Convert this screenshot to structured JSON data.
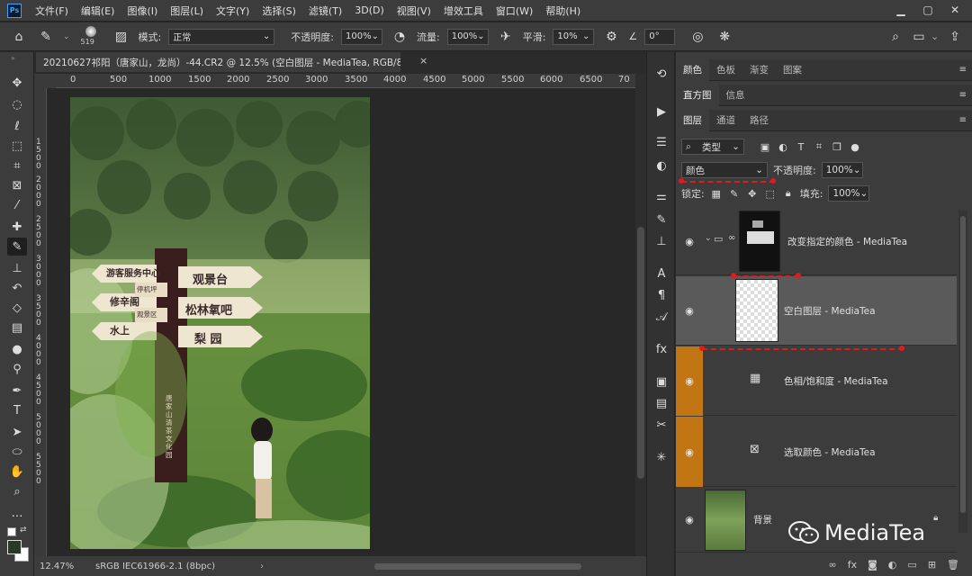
{
  "app": {
    "logo_text": "Ps"
  },
  "menu": [
    "文件(F)",
    "编辑(E)",
    "图像(I)",
    "图层(L)",
    "文字(Y)",
    "选择(S)",
    "滤镜(T)",
    "3D(D)",
    "视图(V)",
    "增效工具",
    "窗口(W)",
    "帮助(H)"
  ],
  "window_controls": {
    "minimize": "▁",
    "maximize": "▢",
    "close": "✕"
  },
  "options": {
    "brush_size": "519",
    "mode_label": "模式:",
    "mode_value": "正常",
    "opacity_label": "不透明度:",
    "opacity_value": "100%",
    "flow_label": "流量:",
    "flow_value": "100%",
    "smooth_label": "平滑:",
    "smooth_value": "10%",
    "angle_value": "0°"
  },
  "document": {
    "tab_title": "20210627祁阳（唐家山，龙尚）-44.CR2 @ 12.5% (空白图层 - MediaTea, RGB/8) *",
    "close": "×",
    "zoom": "12.47%",
    "color_profile": "sRGB IEC61966-2.1 (8bpc)",
    "status_arrow": "›"
  },
  "ruler": {
    "h_ticks": [
      "0",
      "500",
      "1000",
      "1500",
      "2000",
      "2500",
      "3000",
      "3500",
      "4000",
      "4500",
      "5000",
      "5500",
      "6000",
      "6500",
      "70"
    ],
    "v_ticks": [
      "1 5 0 0",
      "2 0 0 0",
      "2 5 0 0",
      "3 0 0 0",
      "3 5 0 0",
      "4 0 0 0",
      "4 5 0 0",
      "5 0 0 0",
      "5 5 0 0"
    ]
  },
  "photo_signs": {
    "left": [
      "游客服务中心",
      "修辛阁",
      "水上"
    ],
    "right": [
      "观景台",
      "松林氧吧",
      "梨  园"
    ],
    "post_small": [
      "停机坪",
      "观景区"
    ],
    "post_vertical": "唐家山清茶文化园"
  },
  "panels": {
    "top_tabs": [
      "颜色",
      "色板",
      "渐变",
      "图案"
    ],
    "mid_tabs": [
      "直方图",
      "信息"
    ],
    "layer_tabs": [
      "图层",
      "通道",
      "路径"
    ],
    "kind_label": "类型",
    "blend_mode": "颜色",
    "opacity_label": "不透明度:",
    "opacity_value": "100%",
    "lock_label": "锁定:",
    "fill_label": "填充:",
    "fill_value": "100%",
    "menu_icon": "≡"
  },
  "layers": [
    {
      "name": "改变指定的颜色 - MediaTea",
      "type": "group"
    },
    {
      "name": "空白图层 - MediaTea",
      "type": "pixel",
      "selected": true
    },
    {
      "name": "色相/饱和度 - MediaTea",
      "type": "adjustment",
      "clipped": true
    },
    {
      "name": "选取颜色 - MediaTea",
      "type": "adjustment",
      "clipped": true
    },
    {
      "name": "背景",
      "type": "background"
    }
  ],
  "layer_bottom_icons": [
    "link-icon",
    "fx-icon",
    "mask-icon",
    "adjustment-icon",
    "folder-icon",
    "new-layer-icon",
    "trash-icon"
  ],
  "watermark": "MediaTea",
  "colors": {
    "accent_orange": "#c27613",
    "annotation_red": "#e01b1b",
    "ps_blue": "#31a8ff"
  }
}
